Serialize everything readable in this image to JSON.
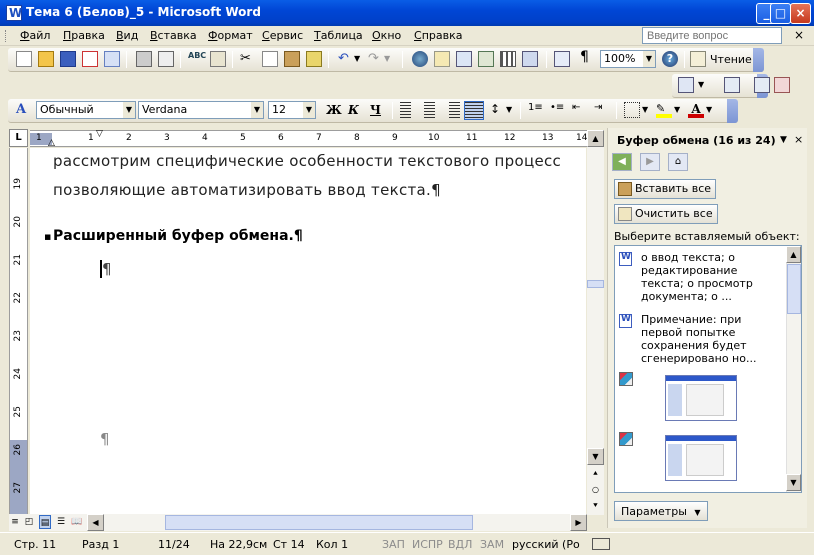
{
  "window": {
    "title": "Тема 6 (Белов)_5 - Microsoft Word"
  },
  "menu": {
    "items": [
      "Файл",
      "Правка",
      "Вид",
      "Вставка",
      "Формат",
      "Сервис",
      "Таблица",
      "Окно",
      "Справка"
    ],
    "help_placeholder": "Введите вопрос"
  },
  "standard_toolbar": {
    "zoom": "100%",
    "read_label": "Чтение"
  },
  "formatting_toolbar": {
    "style": "Обычный",
    "font": "Verdana",
    "size": "12",
    "bold": "Ж",
    "italic": "К",
    "underline": "Ч"
  },
  "hruler": {
    "ticks": [
      "1",
      "1",
      "2",
      "3",
      "4",
      "5",
      "6",
      "7",
      "8",
      "9",
      "10",
      "11",
      "12",
      "13",
      "14"
    ]
  },
  "vruler": {
    "ticks": [
      "19",
      "20",
      "21",
      "22",
      "23",
      "24",
      "25",
      "26",
      "27"
    ]
  },
  "document": {
    "line1": "рассмотрим специфические особенности текстового процесс",
    "line2": "позволяющие автоматизировать ввод текста.¶",
    "heading": "Расширенный буфер обмена.¶",
    "bullet": "▪",
    "para_mark_1": "¶",
    "para_mark_2": "¶"
  },
  "task_pane": {
    "title": "Буфер обмена (16 из 24)",
    "paste_all": "Вставить все",
    "clear_all": "Очистить все",
    "select_label": "Выберите вставляемый объект:",
    "items": [
      {
        "text": "о ввод текста; о редактирование текста; о просмотр документа; о ..."
      },
      {
        "text": "Примечание: при первой попытке сохранения будет сгенерировано но..."
      }
    ],
    "params": "Параметры"
  },
  "status": {
    "page": "Стр. 11",
    "section": "Разд 1",
    "count": "11/24",
    "at": "На 22,9см",
    "line": "Ст 14",
    "col": "Кол 1",
    "rec": "ЗАП",
    "trk": "ИСПР",
    "ext": "ВДЛ",
    "ovr": "ЗАМ",
    "lang": "русский (Ро"
  },
  "colors": {
    "title_bar": "#0046d5",
    "ruler_margin": "#9ca7c4",
    "pane_bg": "#f1efe2"
  }
}
